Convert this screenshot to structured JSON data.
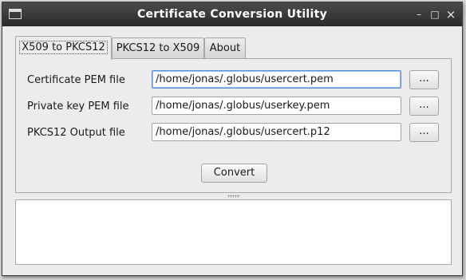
{
  "window": {
    "title": "Certificate Conversion Utility",
    "icon": "window-app-icon",
    "controls": {
      "minimize": "–",
      "maximize": "□",
      "close": "×"
    }
  },
  "tabs": [
    {
      "label": "X509 to PKCS12",
      "active": true
    },
    {
      "label": "PKCS12 to X509",
      "active": false
    },
    {
      "label": "About",
      "active": false
    }
  ],
  "form": {
    "rows": [
      {
        "label": "Certificate PEM file",
        "value": "/home/jonas/.globus/usercert.pem",
        "browse": "..."
      },
      {
        "label": "Private key PEM file",
        "value": "/home/jonas/.globus/userkey.pem",
        "browse": "..."
      },
      {
        "label": "PKCS12 Output file",
        "value": "/home/jonas/.globus/usercert.p12",
        "browse": "..."
      }
    ],
    "convert_label": "Convert"
  },
  "output": {
    "text": ""
  },
  "colors": {
    "titlebar": "#2b2b2b",
    "focus": "#5b8dd4",
    "background": "#ececec"
  }
}
